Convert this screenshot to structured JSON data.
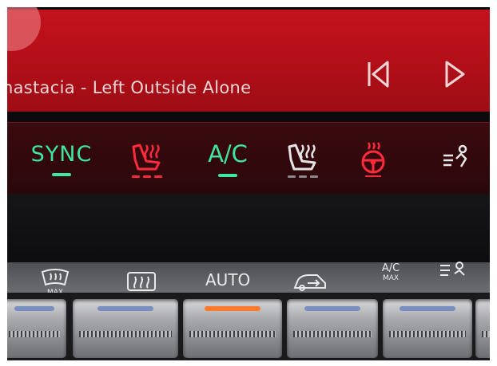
{
  "media": {
    "track": "nastacia - Left Outside Alone",
    "prev_icon": "skip-previous-icon",
    "play_icon": "play-icon",
    "colors": {
      "bar": "#b81019",
      "text": "#f4d6d7"
    }
  },
  "climate": {
    "sync_label": "SYNC",
    "ac_label": "A/C",
    "items": [
      {
        "name": "sync",
        "active": true,
        "color": "#3ee6a0"
      },
      {
        "name": "seat-heat-left",
        "icon": "seat-heat-icon",
        "active": true,
        "color": "#ff2b3a"
      },
      {
        "name": "ac",
        "active": true,
        "color": "#3ee6a0"
      },
      {
        "name": "seat-heat-right",
        "icon": "seat-heat-icon",
        "active": false,
        "color": "#d0d0d0"
      },
      {
        "name": "steering-heat",
        "icon": "steering-wheel-heat-icon",
        "active": true,
        "color": "#ff2b3a"
      },
      {
        "name": "airflow",
        "icon": "airflow-person-icon",
        "active": false,
        "color": "#e8e8e8"
      }
    ]
  },
  "panel": {
    "auto_label": "AUTO",
    "ac_max_top": "A/C",
    "ac_max_bottom": "MAX",
    "front_defrost_label": "MAX",
    "icons": [
      "front-defrost-max-icon",
      "rear-defrost-icon",
      "auto-label",
      "recirculation-icon",
      "ac-max-label",
      "airflow-fan-icon"
    ],
    "led_colors": {
      "active": "#ff7a2a",
      "inactive": "#7a8fc0"
    }
  }
}
